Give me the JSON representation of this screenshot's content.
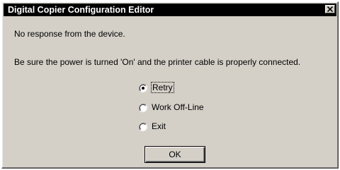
{
  "dialog": {
    "title": "Digital Copier Configuration Editor",
    "message_primary": "No response from the device.",
    "message_secondary": "Be sure the power is turned 'On' and the printer cable is properly connected."
  },
  "options": [
    {
      "label": "Retry",
      "selected": true
    },
    {
      "label": "Work Off-Line",
      "selected": false
    },
    {
      "label": "Exit",
      "selected": false
    }
  ],
  "buttons": {
    "ok_label": "OK"
  },
  "icons": {
    "close": "close-icon",
    "radio_selected": "radio-selected-icon",
    "radio_unselected": "radio-unselected-icon"
  },
  "colors": {
    "titlebar_bg": "#000000",
    "titlebar_text": "#ffffff",
    "dialog_bg": "#d4d0c8"
  }
}
